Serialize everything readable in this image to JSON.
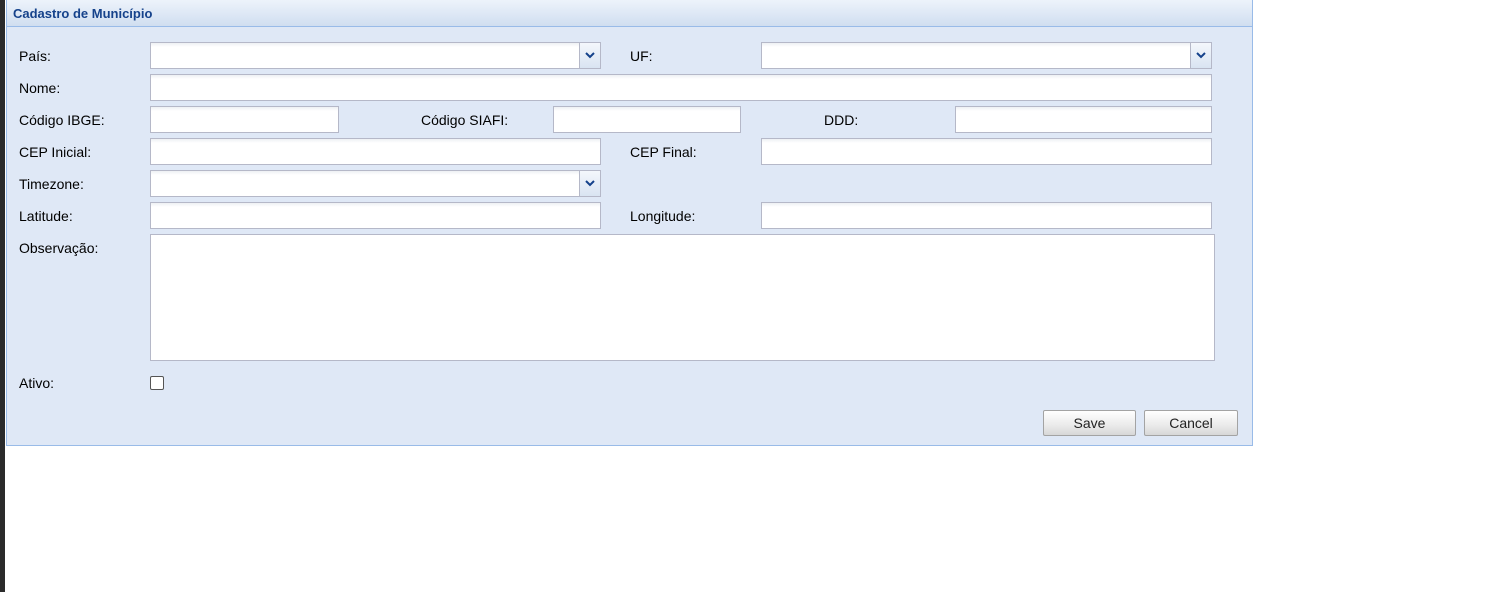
{
  "panel": {
    "title": "Cadastro de Município"
  },
  "form": {
    "pais": {
      "label": "País:",
      "value": ""
    },
    "uf": {
      "label": "UF:",
      "value": ""
    },
    "nome": {
      "label": "Nome:",
      "value": ""
    },
    "codigo_ibge": {
      "label": "Código IBGE:",
      "value": ""
    },
    "codigo_siafi": {
      "label": "Código SIAFI:",
      "value": ""
    },
    "ddd": {
      "label": "DDD:",
      "value": ""
    },
    "cep_inicial": {
      "label": "CEP Inicial:",
      "value": ""
    },
    "cep_final": {
      "label": "CEP Final:",
      "value": ""
    },
    "timezone": {
      "label": "Timezone:",
      "value": ""
    },
    "latitude": {
      "label": "Latitude:",
      "value": ""
    },
    "longitude": {
      "label": "Longitude:",
      "value": ""
    },
    "observacao": {
      "label": "Observação:",
      "value": ""
    },
    "ativo": {
      "label": "Ativo:",
      "checked": false
    }
  },
  "buttons": {
    "save": "Save",
    "cancel": "Cancel"
  },
  "icons": {
    "combo_trigger": "chevron-down-icon"
  },
  "colors": {
    "panel_bg": "#dfe8f6",
    "title": "#15428b",
    "border": "#99bbe8"
  }
}
